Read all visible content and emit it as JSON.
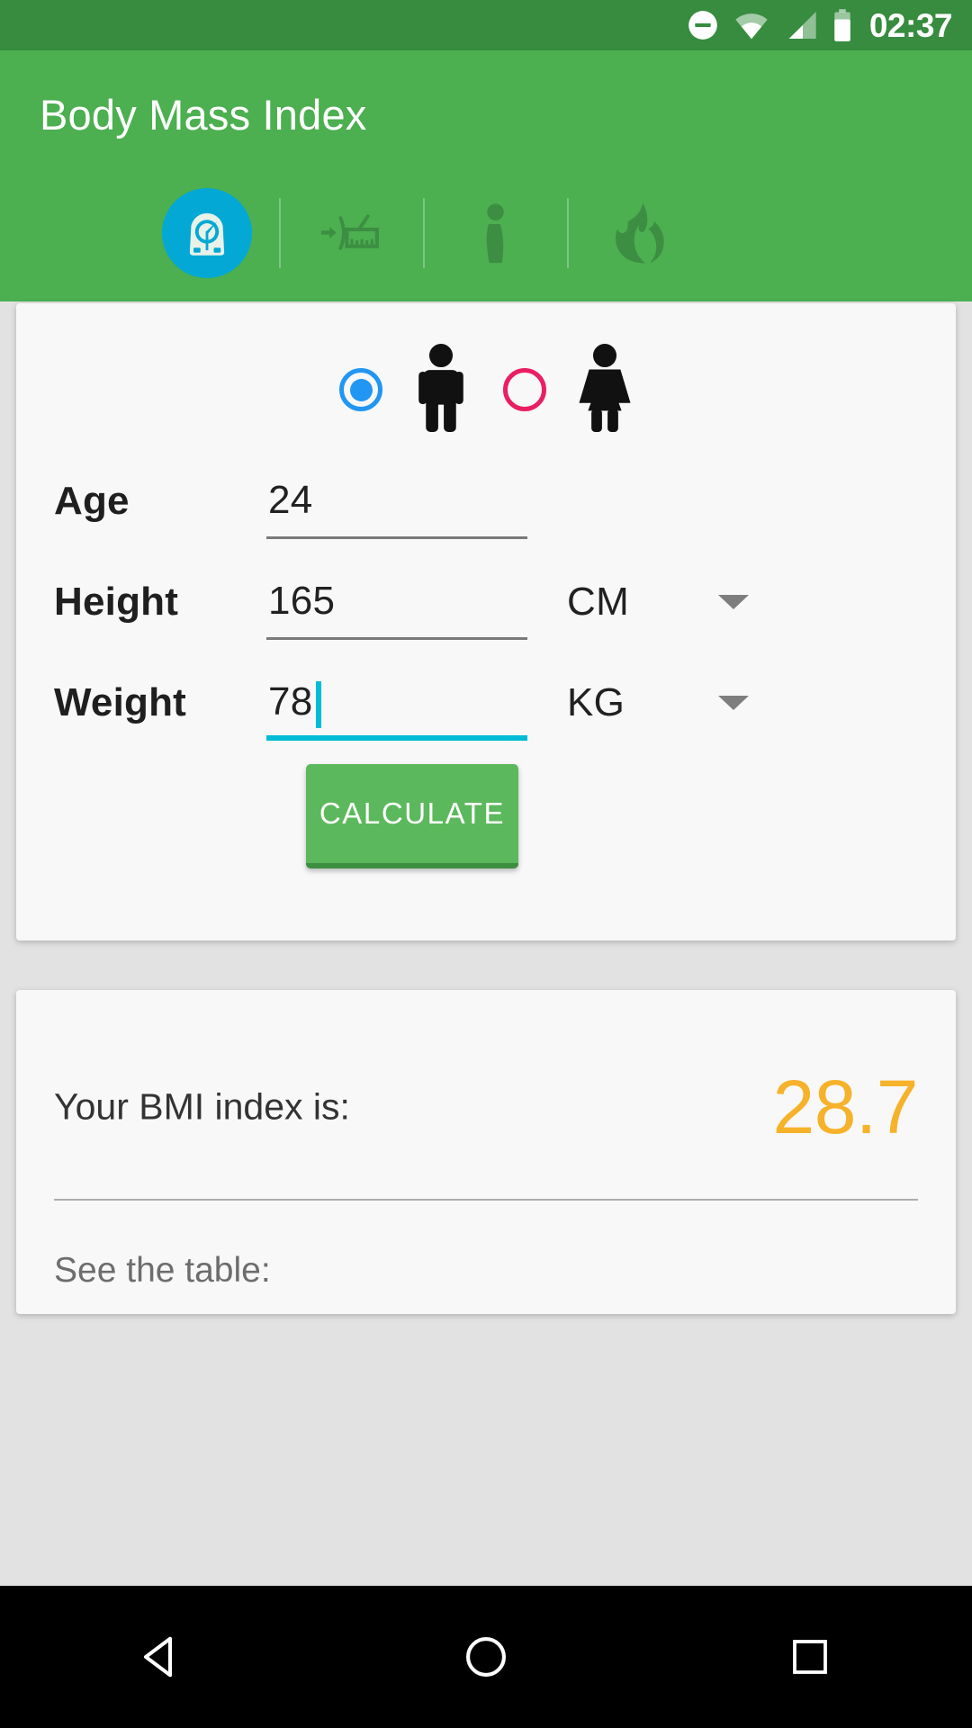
{
  "status_bar": {
    "time": "02:37",
    "icons": [
      "do-not-disturb-icon",
      "wifi-icon",
      "cellular-signal-icon",
      "battery-icon"
    ]
  },
  "app_bar": {
    "title": "Body Mass Index",
    "background_color": "#4CAF50",
    "status_background_color": "#378C3F",
    "tabs": [
      {
        "name": "bmi-scale",
        "icon": "scale-icon",
        "selected": true,
        "selected_bg": "#03A9D4"
      },
      {
        "name": "waist-measure",
        "icon": "measuring-tape-icon",
        "selected": false
      },
      {
        "name": "body-shape",
        "icon": "body-silhouette-icon",
        "selected": false
      },
      {
        "name": "calories",
        "icon": "flame-icon",
        "selected": false
      }
    ]
  },
  "form": {
    "gender": {
      "selected": "male",
      "male": {
        "label_icon": "male-figure-icon",
        "radio_color": "#2196F3",
        "checked": true
      },
      "female": {
        "label_icon": "female-figure-icon",
        "radio_color": "#E91E63",
        "checked": false
      }
    },
    "fields": [
      {
        "name": "age",
        "label": "Age",
        "value": "24",
        "placeholder": "",
        "unit": "",
        "has_unit": false,
        "focused": false
      },
      {
        "name": "height",
        "label": "Height",
        "value": "165",
        "placeholder": "",
        "unit": "CM",
        "has_unit": true,
        "focused": false
      },
      {
        "name": "weight",
        "label": "Weight",
        "value": "78",
        "placeholder": "",
        "unit": "KG",
        "has_unit": true,
        "focused": true
      }
    ],
    "calculate_button": {
      "label": "CALCULATE",
      "color": "#5CB85C"
    }
  },
  "result": {
    "label": "Your BMI index is:",
    "value": "28.7",
    "value_color": "#F5B22A",
    "see_table_label": "See the table:"
  },
  "nav_bar": {
    "back": "back-triangle-icon",
    "home": "home-circle-icon",
    "recents": "recents-square-icon"
  }
}
